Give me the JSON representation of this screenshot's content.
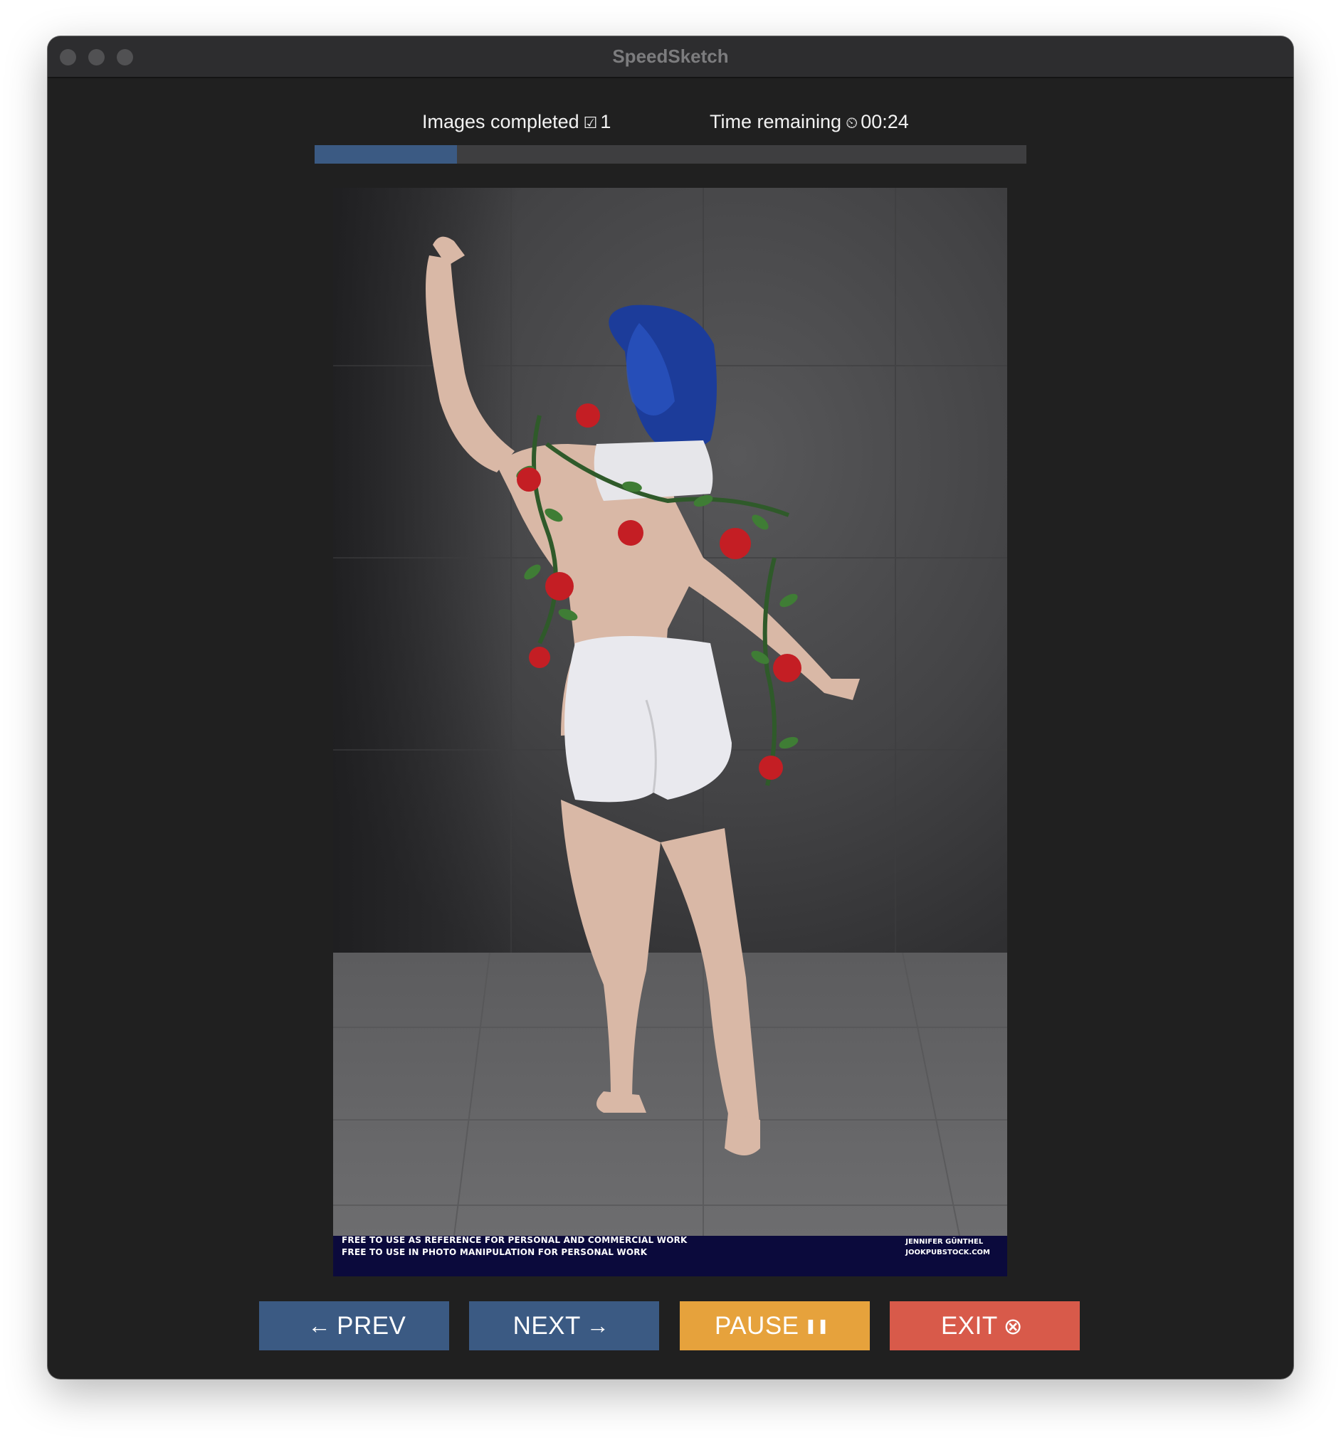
{
  "window": {
    "title": "SpeedSketch"
  },
  "stats": {
    "images_completed_label": "Images completed",
    "images_completed_icon": "☑",
    "images_completed_value": "1",
    "time_remaining_label": "Time remaining",
    "time_remaining_icon": "⏲",
    "time_remaining_value": "00:24"
  },
  "progress": {
    "fraction": 0.2,
    "fill_color": "#3b5a83",
    "track_color": "#3e3e40"
  },
  "photo": {
    "watermark_line1": "FREE TO USE AS REFERENCE FOR PERSONAL AND COMMERCIAL WORK",
    "watermark_line2": "FREE TO USE IN PHOTO MANIPULATION FOR PERSONAL WORK",
    "credit_line1": "JENNIFER GÜNTHEL",
    "credit_line2": "JOOKPUBSTOCK.COM"
  },
  "buttons": {
    "prev_icon": "←",
    "prev_label": "PREV",
    "next_label": "NEXT",
    "next_icon": "→",
    "pause_label": "PAUSE",
    "pause_icon": "❚❚",
    "exit_label": "EXIT",
    "exit_icon": "⊗"
  },
  "colors": {
    "primary": "#3b5a83",
    "pause": "#e6a23c",
    "exit": "#d85a4a",
    "background": "#202020"
  }
}
